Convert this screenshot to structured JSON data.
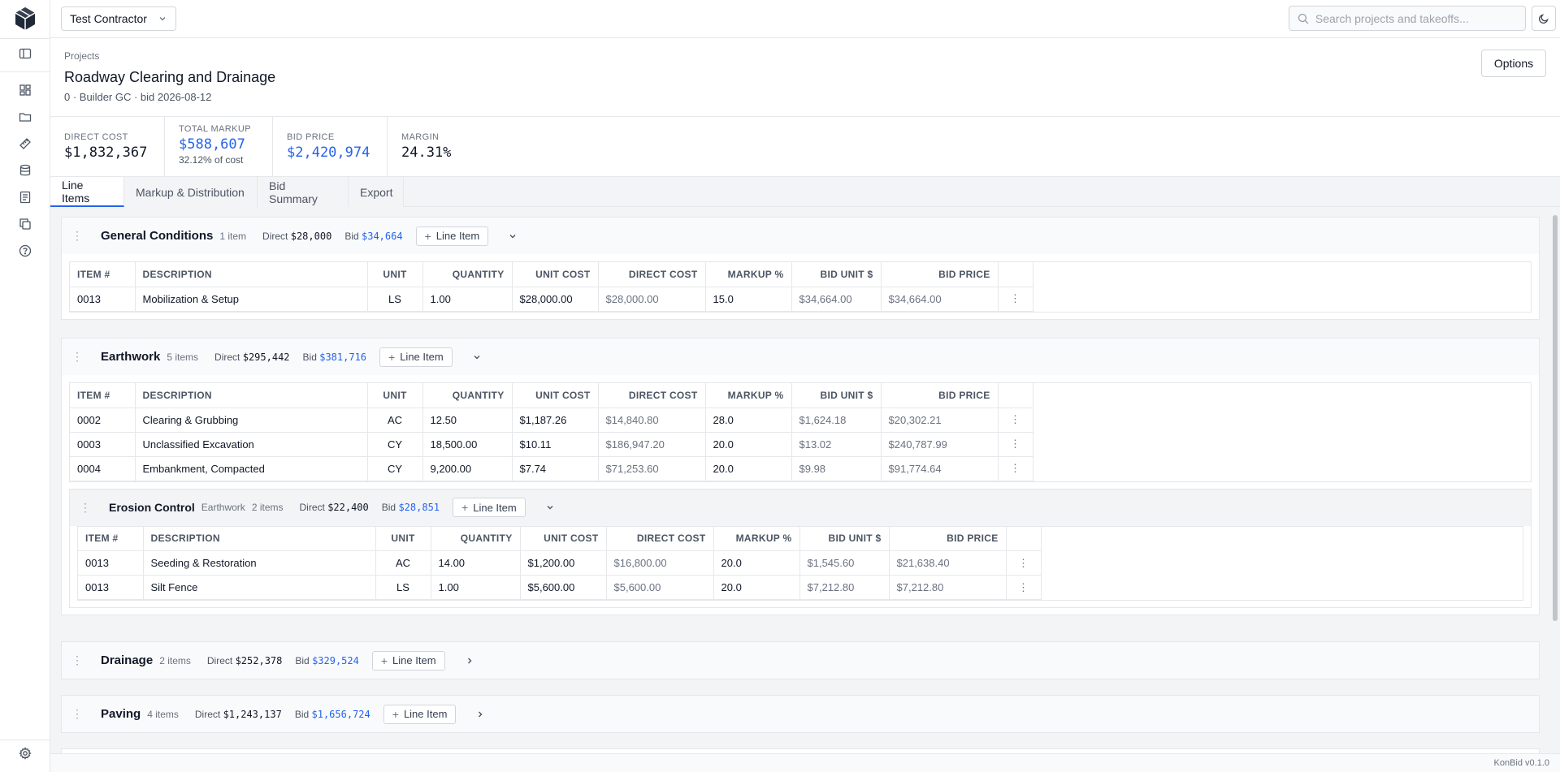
{
  "topbar": {
    "org": "Test Contractor",
    "search_placeholder": "Search projects and takeoffs..."
  },
  "project": {
    "breadcrumb": "Projects",
    "title": "Roadway Clearing and Drainage",
    "subtitle": "0 · Builder GC · bid 2026-08-12",
    "options_label": "Options"
  },
  "stats": [
    {
      "label": "DIRECT COST",
      "value": "$1,832,367",
      "sub": ""
    },
    {
      "label": "TOTAL MARKUP",
      "value": "$588,607",
      "sub": "32.12% of cost"
    },
    {
      "label": "BID PRICE",
      "value": "$2,420,974",
      "sub": ""
    },
    {
      "label": "MARGIN",
      "value": "24.31%",
      "sub": ""
    }
  ],
  "tabs": [
    "Line Items",
    "Markup & Distribution",
    "Bid Summary",
    "Export"
  ],
  "columns": [
    "ITEM #",
    "DESCRIPTION",
    "UNIT",
    "QUANTITY",
    "UNIT COST",
    "DIRECT COST",
    "MARKUP %",
    "BID UNIT $",
    "BID PRICE"
  ],
  "add_line_label": "Line Item",
  "groups": {
    "general": {
      "name": "General Conditions",
      "count": "1 item",
      "direct_label": "Direct",
      "direct": "$28,000",
      "bid_label": "Bid",
      "bid": "$34,664",
      "rows": [
        [
          "0013",
          "Mobilization & Setup",
          "LS",
          "1.00",
          "$28,000.00",
          "$28,000.00",
          "15.0",
          "$34,664.00",
          "$34,664.00"
        ]
      ]
    },
    "earthwork": {
      "name": "Earthwork",
      "count": "5 items",
      "direct_label": "Direct",
      "direct": "$295,442",
      "bid_label": "Bid",
      "bid": "$381,716",
      "rows": [
        [
          "0002",
          "Clearing & Grubbing",
          "AC",
          "12.50",
          "$1,187.26",
          "$14,840.80",
          "28.0",
          "$1,624.18",
          "$20,302.21"
        ],
        [
          "0003",
          "Unclassified Excavation",
          "CY",
          "18,500.00",
          "$10.11",
          "$186,947.20",
          "20.0",
          "$13.02",
          "$240,787.99"
        ],
        [
          "0004",
          "Embankment, Compacted",
          "CY",
          "9,200.00",
          "$7.74",
          "$71,253.60",
          "20.0",
          "$9.98",
          "$91,774.64"
        ]
      ]
    },
    "erosion": {
      "name": "Erosion Control",
      "parent": "Earthwork",
      "count": "2 items",
      "direct_label": "Direct",
      "direct": "$22,400",
      "bid_label": "Bid",
      "bid": "$28,851",
      "rows": [
        [
          "0013",
          "Seeding & Restoration",
          "AC",
          "14.00",
          "$1,200.00",
          "$16,800.00",
          "20.0",
          "$1,545.60",
          "$21,638.40"
        ],
        [
          "0013",
          "Silt Fence",
          "LS",
          "1.00",
          "$5,600.00",
          "$5,600.00",
          "20.0",
          "$7,212.80",
          "$7,212.80"
        ]
      ]
    },
    "drainage": {
      "name": "Drainage",
      "count": "2 items",
      "direct_label": "Direct",
      "direct": "$252,378",
      "bid_label": "Bid",
      "bid": "$329,524"
    },
    "paving": {
      "name": "Paving",
      "count": "4 items",
      "direct_label": "Direct",
      "direct": "$1,243,137",
      "bid_label": "Bid",
      "bid": "$1,656,724"
    }
  },
  "footer": {
    "version": "KonBid v0.1.0"
  }
}
